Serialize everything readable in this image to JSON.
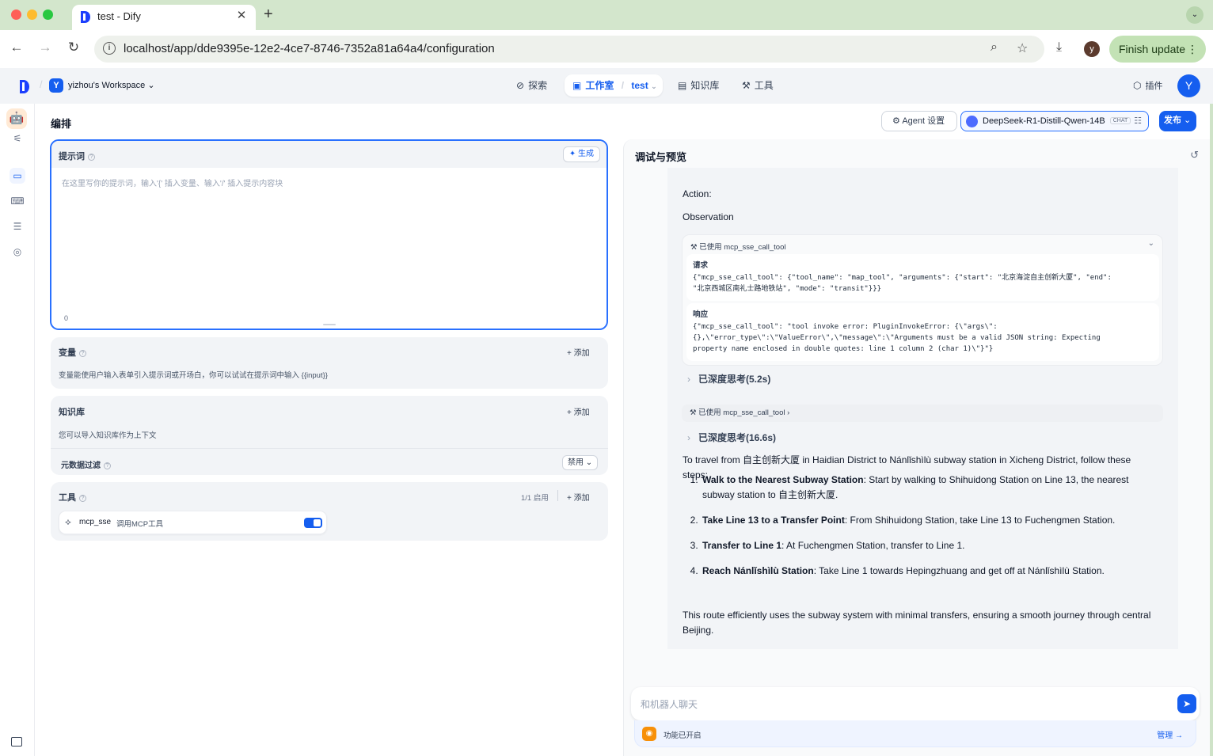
{
  "browser": {
    "tab_title": "test - Dify",
    "url": "localhost/app/dde9395e-12e2-4ce7-8746-7352a81a64a4/configuration",
    "profile_initial": "y",
    "finish_update": "Finish update"
  },
  "header": {
    "workspace_initial": "Y",
    "workspace_name": "yizhou's Workspace",
    "nav": {
      "explore": "探索",
      "studio": "工作室",
      "app_name": "test",
      "knowledge": "知识库",
      "tools": "工具"
    },
    "plugins": "插件",
    "user_initial": "Y"
  },
  "main": {
    "title": "编排",
    "agent_settings": "Agent 设置",
    "model_name": "DeepSeek-R1-Distill-Qwen-14B",
    "model_badge": "CHAT",
    "publish": "发布"
  },
  "prompt": {
    "label": "提示词",
    "generate": "生成",
    "placeholder": "在这里写你的提示词，输入'{' 插入变量、输入'/' 插入提示内容块",
    "count": "0"
  },
  "variables": {
    "label": "变量",
    "add": "添加",
    "desc": "变量能使用户输入表单引入提示词或开场白，你可以试试在提示词中输入 {{input}}"
  },
  "knowledge": {
    "label": "知识库",
    "add": "添加",
    "desc": "您可以导入知识库作为上下文",
    "metadata_filter": "元数据过滤",
    "metadata_value": "禁用"
  },
  "tools": {
    "label": "工具",
    "enabled_count": "1/1 启用",
    "add": "添加",
    "items": [
      {
        "name": "mcp_sse",
        "desc": "调用MCP工具",
        "enabled": true
      }
    ]
  },
  "debug": {
    "title": "调试与预览",
    "action": "Action:",
    "observation": "Observation",
    "tool_used_label": "已使用 mcp_sse_call_tool",
    "request_label": "请求",
    "request_body": "{\"mcp_sse_call_tool\": {\"tool_name\": \"map_tool\", \"arguments\": {\"start\": \"北京海淀自主创新大厦\", \"end\":\n\"北京西城区南礼士路地铁站\", \"mode\": \"transit\"}}}",
    "response_label": "响应",
    "response_body": "{\"mcp_sse_call_tool\": \"tool invoke error: PluginInvokeError: {\\\"args\\\":\n{},\\\"error_type\\\":\\\"ValueError\\\",\\\"message\\\":\\\"Arguments must be a valid JSON string: Expecting\nproperty name enclosed in double quotes: line 1 column 2 (char 1)\\\"}\"}",
    "think_1": "已深度思考(5.2s)",
    "tool_used_label_2": "已使用 mcp_sse_call_tool",
    "think_2": "已深度思考(16.6s)",
    "intro": "To travel from 自主创新大厦 in Haidian District to Nánlǐshìlù subway station in Xicheng District, follow these steps:",
    "steps": [
      {
        "title": "Walk to the Nearest Subway Station",
        "text": ": Start by walking to Shihuidong Station on Line 13, the nearest subway station to 自主创新大厦."
      },
      {
        "title": "Take Line 13 to a Transfer Point",
        "text": ": From Shihuidong Station, take Line 13 to Fuchengmen Station."
      },
      {
        "title": "Transfer to Line 1",
        "text": ": At Fuchengmen Station, transfer to Line 1."
      },
      {
        "title": "Reach Nánlǐshìlù Station",
        "text": ": Take Line 1 towards Hepingzhuang and get off at Nánlǐshìlù Station."
      }
    ],
    "outro": "This route efficiently uses the subway system with minimal transfers, ensuring a smooth journey through central Beijing.",
    "chat_placeholder": "和机器人聊天",
    "features_enabled": "功能已开启",
    "manage": "管理"
  }
}
